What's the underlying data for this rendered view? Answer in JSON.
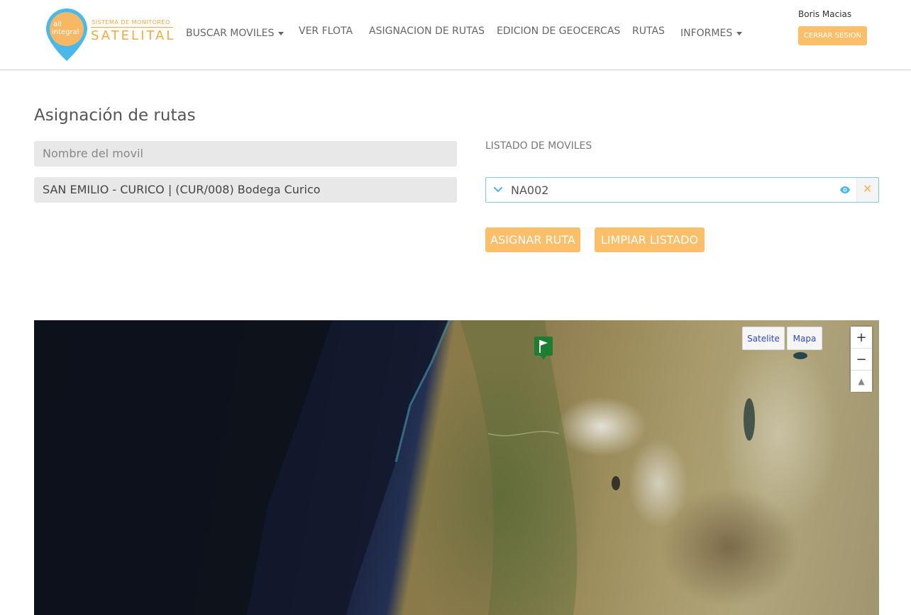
{
  "header": {
    "logo": {
      "pin_text_line1": "all",
      "pin_text_line2": "integral",
      "tagline": "SISTEMA DE MONITOREO",
      "wordmark": "SATELITAL"
    },
    "nav": [
      {
        "label": "BUSCAR MOVILES",
        "has_dropdown": true
      },
      {
        "label": "VER FLOTA",
        "has_dropdown": false
      },
      {
        "label": "ASIGNACION DE RUTAS",
        "has_dropdown": false
      },
      {
        "label": "EDICION DE GEOCERCAS",
        "has_dropdown": false
      },
      {
        "label": "RUTAS",
        "has_dropdown": false
      },
      {
        "label": "INFORMES",
        "has_dropdown": true
      }
    ],
    "user_name": "Boris Macias",
    "logout_label": "CERRAR SESION"
  },
  "page": {
    "title": "Asignación de rutas",
    "movil_placeholder": "Nombre del movil",
    "route_value": "SAN EMILIO - CURICO | (CUR/008) Bodega Curico",
    "list_label": "LISTADO DE MOVILES",
    "mobiles": [
      {
        "name": "NA002"
      }
    ],
    "assign_button": "ASIGNAR RUTA",
    "clear_button": "LIMPIAR LISTADO"
  },
  "map": {
    "type_satellite": "Satelite",
    "type_map": "Mapa",
    "zoom_in": "+",
    "zoom_out": "−",
    "compass": "▲"
  },
  "colors": {
    "accent": "#fbbf6a",
    "logo_blue": "#4ab8e8",
    "logo_orange": "#f5a83c",
    "marker_green": "#1e7d32",
    "list_border": "#7fc9e8"
  },
  "icons": {
    "logo": "location-pin-icon",
    "dropdown": "caret-down-icon",
    "list_toggle": "chevron-down-icon",
    "view": "eye-icon",
    "remove": "close-icon",
    "marker": "flag-marker-icon",
    "compass": "compass-icon"
  }
}
